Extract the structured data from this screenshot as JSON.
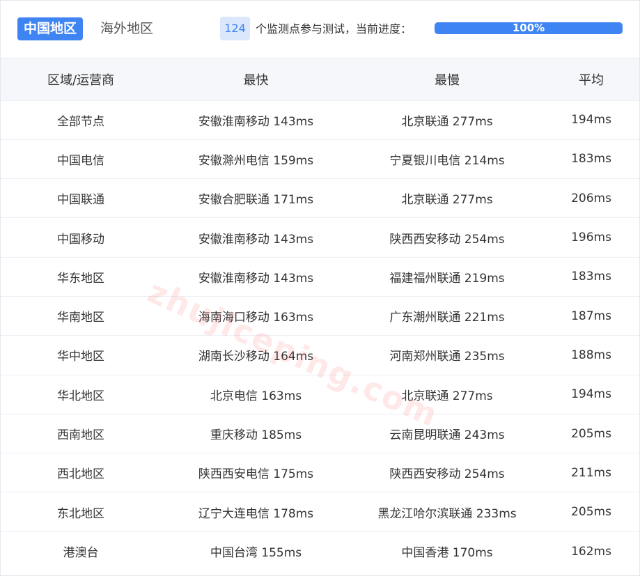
{
  "tabs": {
    "active": "中国地区",
    "inactive": "海外地区"
  },
  "status": {
    "node_count": "124",
    "info_text": "个监测点参与测试，当前进度：",
    "progress_label": "100%",
    "progress_value": 1.0
  },
  "table": {
    "headers": [
      "区域/运营商",
      "最快",
      "最慢",
      "平均"
    ],
    "rows": [
      [
        "全部节点",
        "安徽淮南移动 143ms",
        "北京联通 277ms",
        "194ms"
      ],
      [
        "中国电信",
        "安徽滁州电信 159ms",
        "宁夏银川电信 214ms",
        "183ms"
      ],
      [
        "中国联通",
        "安徽合肥联通 171ms",
        "北京联通 277ms",
        "206ms"
      ],
      [
        "中国移动",
        "安徽淮南移动 143ms",
        "陕西西安移动 254ms",
        "196ms"
      ],
      [
        "华东地区",
        "安徽淮南移动 143ms",
        "福建福州联通 219ms",
        "183ms"
      ],
      [
        "华南地区",
        "海南海口移动 163ms",
        "广东潮州联通 221ms",
        "187ms"
      ],
      [
        "华中地区",
        "湖南长沙移动 164ms",
        "河南郑州联通 235ms",
        "188ms"
      ],
      [
        "华北地区",
        "北京电信 163ms",
        "北京联通 277ms",
        "194ms"
      ],
      [
        "西南地区",
        "重庆移动 185ms",
        "云南昆明联通 243ms",
        "205ms"
      ],
      [
        "西北地区",
        "陕西西安电信 175ms",
        "陕西西安移动 254ms",
        "211ms"
      ],
      [
        "东北地区",
        "辽宁大连电信 178ms",
        "黑龙江哈尔滨联通 233ms",
        "205ms"
      ],
      [
        "港澳台",
        "中国台湾 155ms",
        "中国香港 170ms",
        "162ms"
      ]
    ]
  },
  "watermark": "zhujiceping.com",
  "colors": {
    "accent": "#3f84f3",
    "badge_bg": "#dbe7fb",
    "header_bg": "#f5f7fa",
    "watermark": "#ff6e6e"
  }
}
